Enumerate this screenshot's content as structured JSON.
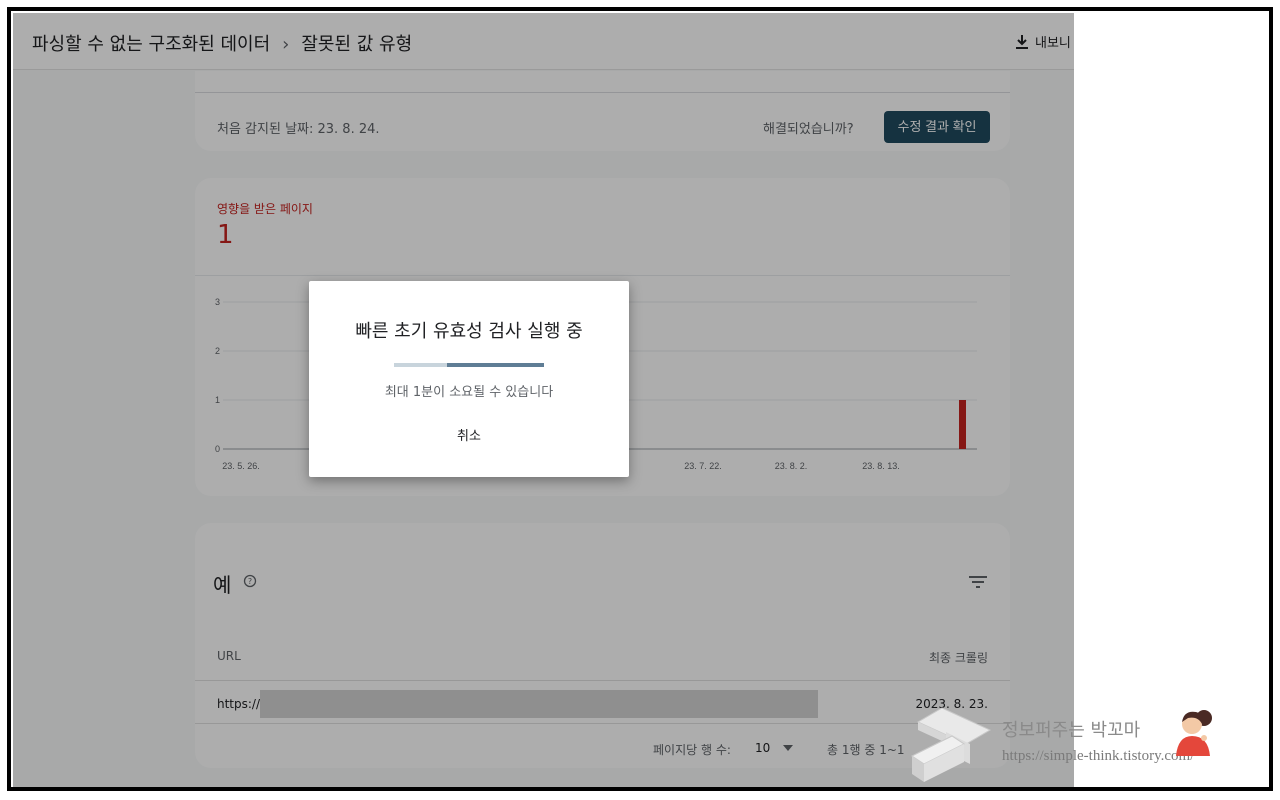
{
  "header": {
    "breadcrumb_parent": "파싱할 수 없는 구조화된 데이터",
    "breadcrumb_separator": "›",
    "breadcrumb_current": "잘못된 값 유형",
    "export_label": "내보니",
    "export_icon": "download-icon"
  },
  "issue_card": {
    "first_detected": "처음 감지된 날짜: 23. 8. 24.",
    "resolved_question": "해결되었습니까?",
    "validate_button": "수정 결과 확인"
  },
  "affected_card": {
    "label": "영향을 받은 페이지",
    "count": "1",
    "accent_color": "#c5221f"
  },
  "chart_data": {
    "type": "bar",
    "title": "",
    "xlabel": "",
    "ylabel": "",
    "y_ticks": [
      "3",
      "2",
      "1",
      "0"
    ],
    "ylim": [
      0,
      3
    ],
    "x_tick_labels": [
      "23. 5. 26.",
      "23. 7. 22.",
      "23. 8. 2.",
      "23. 8. 13."
    ],
    "categories": [
      "23. 8. 24."
    ],
    "values": [
      1
    ],
    "bar_color": "#c5221f",
    "grid": true
  },
  "examples": {
    "title": "예",
    "help_icon": "help-circle-icon",
    "filter_icon": "filter-icon",
    "columns": [
      "URL",
      "최종 크롤링"
    ],
    "rows": [
      {
        "url": "https://s",
        "last_crawl": "2023. 8. 23."
      }
    ],
    "rows_per_page_label": "페이지당 행 수:",
    "rows_per_page_value": "10",
    "page_range": "총 1행 중 1~1"
  },
  "dialog": {
    "title": "빠른 초기 유효성 검사 실행 중",
    "progress": 0.67,
    "message": "최대 1분이 소요될 수 있습니다",
    "cancel_button": "취소"
  },
  "watermark": {
    "title": "정보퍼주는 박꼬마",
    "url": "https://simple-think.tistory.com/"
  }
}
